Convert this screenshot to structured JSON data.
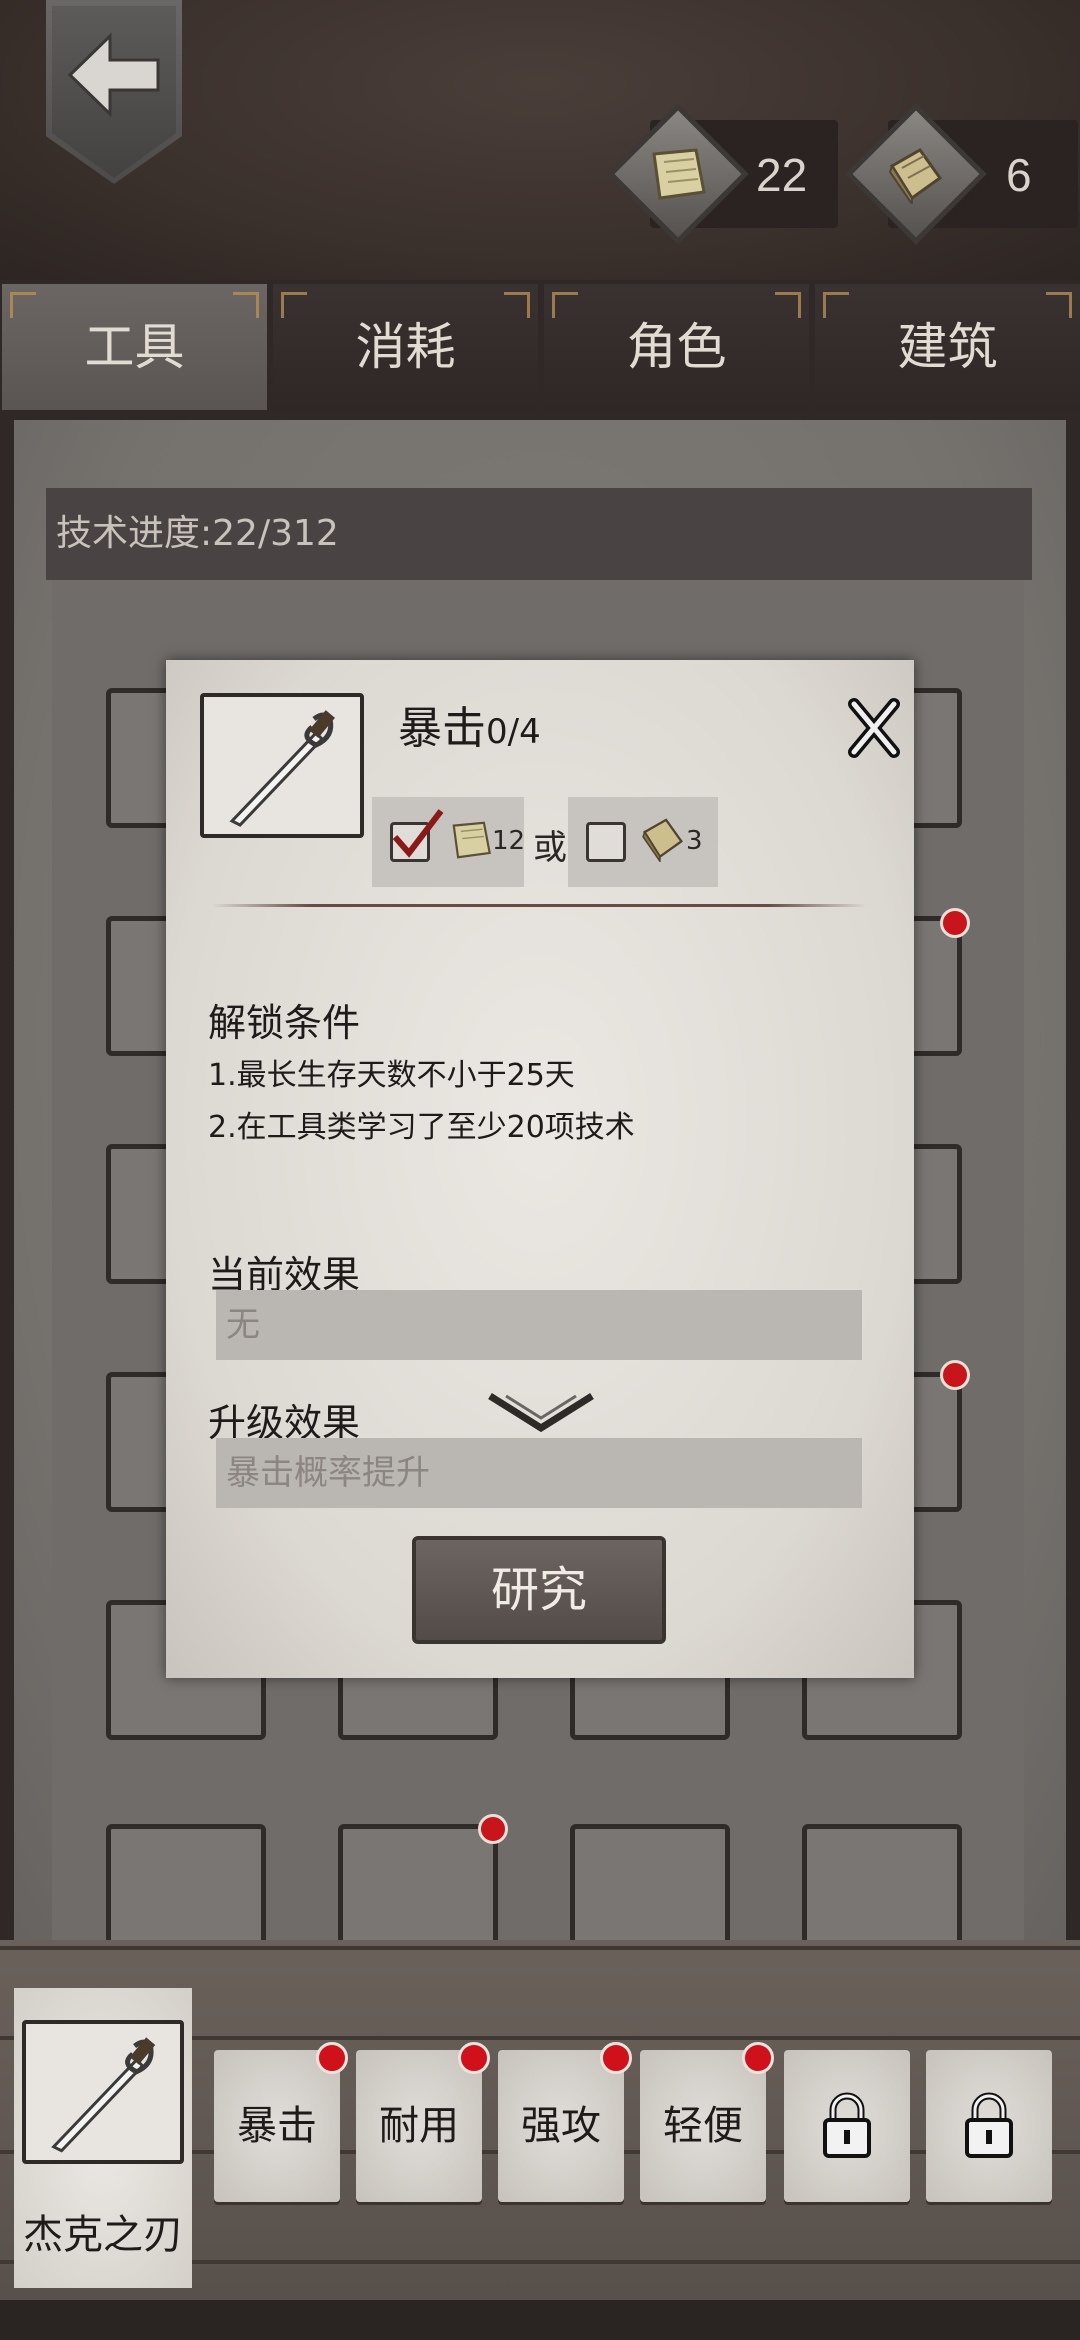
{
  "header": {
    "back_label": "",
    "resources": [
      {
        "icon": "paper-icon",
        "value": "22"
      },
      {
        "icon": "book-icon",
        "value": "6"
      }
    ]
  },
  "tabs": [
    {
      "label": "工具",
      "active": true
    },
    {
      "label": "消耗",
      "active": false
    },
    {
      "label": "角色",
      "active": false
    },
    {
      "label": "建筑",
      "active": false
    }
  ],
  "progress": {
    "text": "技术进度:22/312"
  },
  "dialog": {
    "skill_name": "暴击",
    "level": "0/4",
    "cost_option_1": {
      "icon": "paper-icon",
      "amount": "12",
      "checked": true
    },
    "or_text": "或",
    "cost_option_2": {
      "icon": "book-icon",
      "amount": "3",
      "checked": false
    },
    "unlock_title": "解锁条件",
    "conditions": [
      "1.最长生存天数不小于25天",
      "2.在工具类学习了至少20项技术"
    ],
    "current_effect_title": "当前效果",
    "current_effect_value": "无",
    "upgrade_effect_title": "升级效果",
    "upgrade_effect_value": "暴击概率提升",
    "research_label": "研究"
  },
  "bottom": {
    "weapon_name": "杰克之刃",
    "skills": [
      {
        "label": "暴击",
        "dot": true
      },
      {
        "label": "耐用",
        "dot": true
      },
      {
        "label": "强攻",
        "dot": true
      },
      {
        "label": "轻便",
        "dot": true
      },
      {
        "label": "",
        "locked": true
      },
      {
        "label": "",
        "locked": true
      }
    ]
  },
  "colors": {
    "accent_red": "#c8141b",
    "tab_corner": "#9a7a4e"
  }
}
